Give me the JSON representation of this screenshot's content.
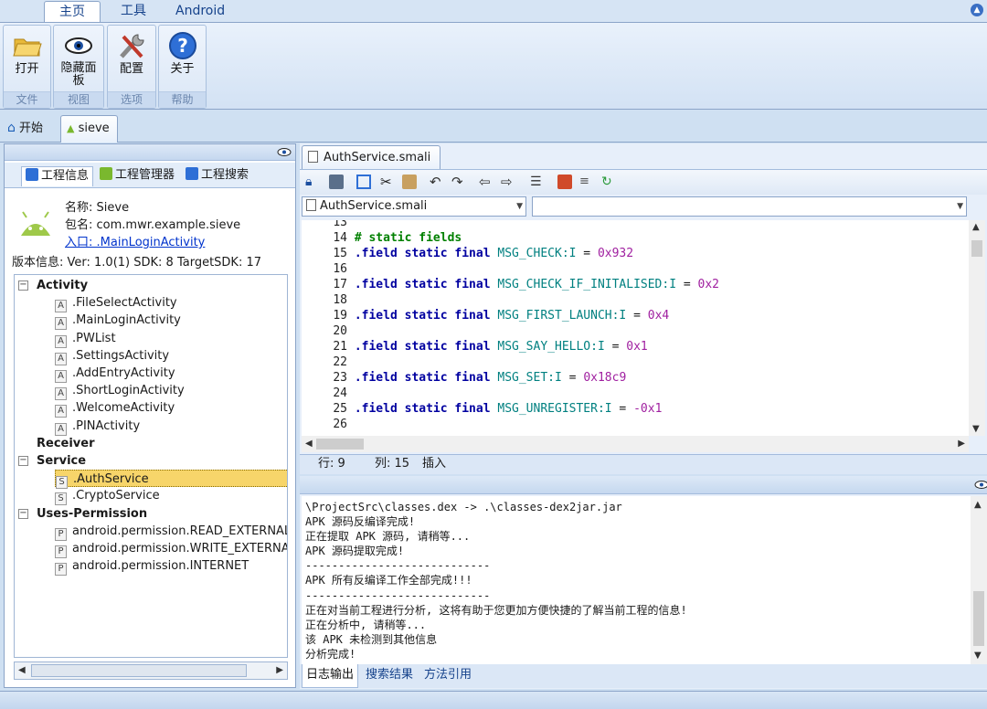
{
  "ribbon_tabs": [
    "主页",
    "工具",
    "Android"
  ],
  "ribbon_groups": [
    {
      "button": "打开",
      "group": "文件",
      "icon": "folder-open-icon"
    },
    {
      "button": "隐藏面板",
      "group": "视图",
      "icon": "eye-icon"
    },
    {
      "button": "配置",
      "group": "选项",
      "icon": "tools-icon"
    },
    {
      "button": "关于",
      "group": "帮助",
      "icon": "help-icon"
    }
  ],
  "doc_tabs": [
    "开始",
    "sieve"
  ],
  "left_tabs": [
    "工程信息",
    "工程管理器",
    "工程搜索"
  ],
  "info": {
    "name_label": "名称:",
    "name": "Sieve",
    "pkg_label": "包名:",
    "pkg": "com.mwr.example.sieve",
    "entry": "入口: .MainLoginActivity",
    "version": "版本信息: Ver: 1.0(1) SDK: 8 TargetSDK: 17"
  },
  "tree": {
    "activity": "Activity",
    "activities": [
      ".FileSelectActivity",
      ".MainLoginActivity",
      ".PWList",
      ".SettingsActivity",
      ".AddEntryActivity",
      ".ShortLoginActivity",
      ".WelcomeActivity",
      ".PINActivity"
    ],
    "receiver": "Receiver",
    "service": "Service",
    "services": [
      ".AuthService",
      ".CryptoService"
    ],
    "uses_permission": "Uses-Permission",
    "permissions": [
      "android.permission.READ_EXTERNAL",
      "android.permission.WRITE_EXTERNA",
      "android.permission.INTERNET"
    ]
  },
  "editor": {
    "tab": "AuthService.smali",
    "combo": "AuthService.smali",
    "lines": [
      {
        "n": "13",
        "t": ""
      },
      {
        "n": "14",
        "t": "# static fields"
      },
      {
        "n": "15",
        "f": "MSG_CHECK:I",
        "v": "0x932"
      },
      {
        "n": "16",
        "t": ""
      },
      {
        "n": "17",
        "f": "MSG_CHECK_IF_INITALISED:I",
        "v": "0x2"
      },
      {
        "n": "18",
        "t": ""
      },
      {
        "n": "19",
        "f": "MSG_FIRST_LAUNCH:I",
        "v": "0x4"
      },
      {
        "n": "20",
        "t": ""
      },
      {
        "n": "21",
        "f": "MSG_SAY_HELLO:I",
        "v": "0x1"
      },
      {
        "n": "22",
        "t": ""
      },
      {
        "n": "23",
        "f": "MSG_SET:I",
        "v": "0x18c9"
      },
      {
        "n": "24",
        "t": ""
      },
      {
        "n": "25",
        "f": "MSG_UNREGISTER:I",
        "v": "-0x1"
      },
      {
        "n": "26",
        "t": ""
      }
    ],
    "keywords": ".field static final",
    "status": {
      "row": "行: 9",
      "col": "列: 15",
      "mode": "插入"
    }
  },
  "log": [
    "\\ProjectSrc\\classes.dex -> .\\classes-dex2jar.jar",
    "APK 源码反编译完成!",
    "正在提取 APK 源码, 请稍等...",
    "APK 源码提取完成!",
    "----------------------------",
    "APK 所有反编译工作全部完成!!!",
    "----------------------------",
    "正在对当前工程进行分析, 这将有助于您更加方便快捷的了解当前工程的信息!",
    "正在分析中, 请稍等...",
    "该 APK 未检测到其他信息",
    "分析完成!"
  ],
  "log_tabs": [
    "日志输出",
    "搜索结果",
    "方法引用"
  ],
  "colors": {
    "accent": "#15428b",
    "selection": "#f7d56a",
    "ribbon": "#d3e2f4"
  }
}
